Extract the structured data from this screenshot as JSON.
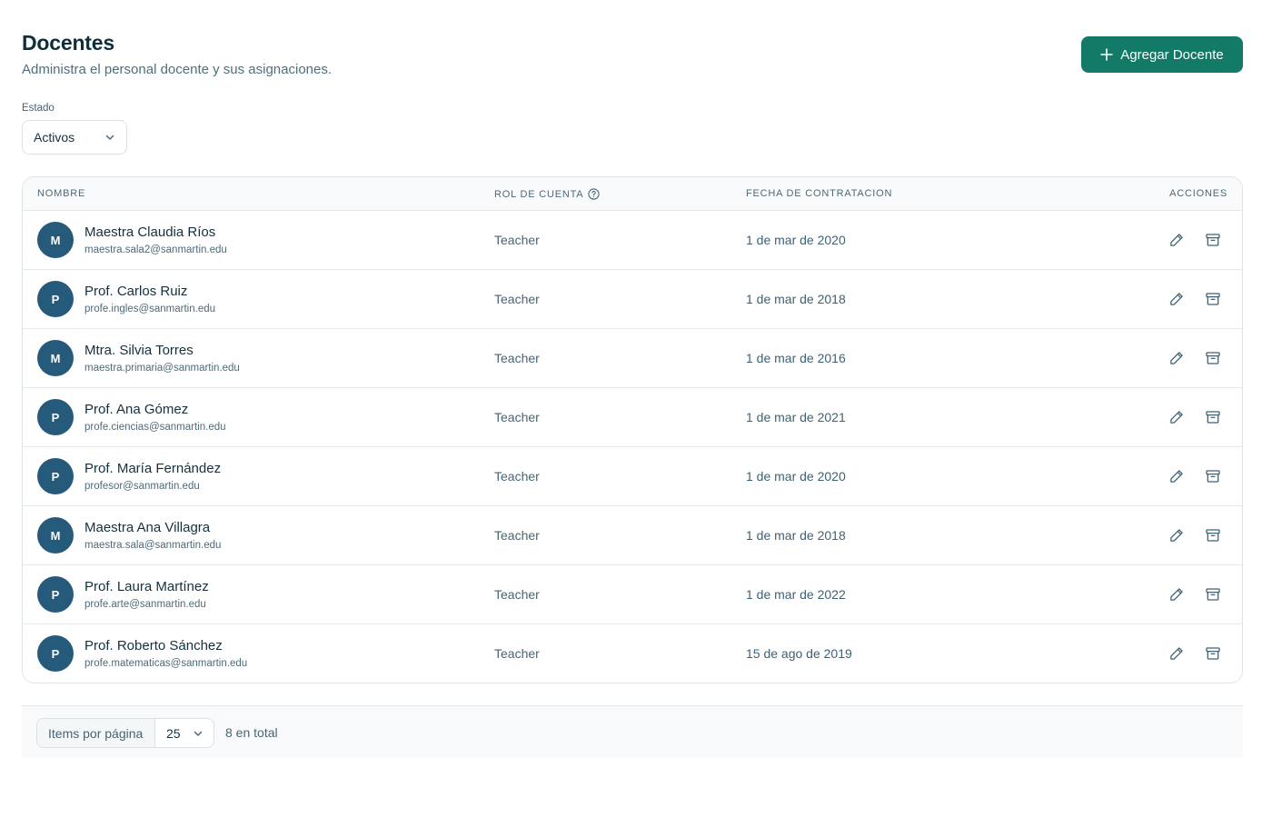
{
  "header": {
    "title": "Docentes",
    "subtitle": "Administra el personal docente y sus asignaciones.",
    "add_button_label": "Agregar Docente"
  },
  "filter": {
    "label": "Estado",
    "selected": "Activos"
  },
  "table": {
    "columns": {
      "name": "NOMBRE",
      "role": "ROL DE CUENTA",
      "date": "FECHA DE CONTRATACION",
      "actions": "ACCIONES"
    },
    "rows": [
      {
        "initial": "M",
        "name": "Maestra Claudia Ríos",
        "email": "maestra.sala2@sanmartin.edu",
        "role": "Teacher",
        "date": "1 de mar de 2020"
      },
      {
        "initial": "P",
        "name": "Prof. Carlos Ruiz",
        "email": "profe.ingles@sanmartin.edu",
        "role": "Teacher",
        "date": "1 de mar de 2018"
      },
      {
        "initial": "M",
        "name": "Mtra. Silvia Torres",
        "email": "maestra.primaria@sanmartin.edu",
        "role": "Teacher",
        "date": "1 de mar de 2016"
      },
      {
        "initial": "P",
        "name": "Prof. Ana Gómez",
        "email": "profe.ciencias@sanmartin.edu",
        "role": "Teacher",
        "date": "1 de mar de 2021"
      },
      {
        "initial": "P",
        "name": "Prof. María Fernández",
        "email": "profesor@sanmartin.edu",
        "role": "Teacher",
        "date": "1 de mar de 2020"
      },
      {
        "initial": "M",
        "name": "Maestra Ana Villagra",
        "email": "maestra.sala@sanmartin.edu",
        "role": "Teacher",
        "date": "1 de mar de 2018"
      },
      {
        "initial": "P",
        "name": "Prof. Laura Martínez",
        "email": "profe.arte@sanmartin.edu",
        "role": "Teacher",
        "date": "1 de mar de 2022"
      },
      {
        "initial": "P",
        "name": "Prof. Roberto Sánchez",
        "email": "profe.matematicas@sanmartin.edu",
        "role": "Teacher",
        "date": "15 de ago de 2019"
      }
    ]
  },
  "pagination": {
    "per_page_label": "Items por página",
    "per_page_value": "25",
    "total_text": "8 en total"
  },
  "colors": {
    "accent": "#127a66",
    "avatar_bg": "#265a7a"
  },
  "icons": {
    "add": "plus-icon",
    "select": "chevron-down-icon",
    "role_help": "help-circle-icon",
    "edit": "pencil-icon",
    "archive": "archive-icon"
  }
}
